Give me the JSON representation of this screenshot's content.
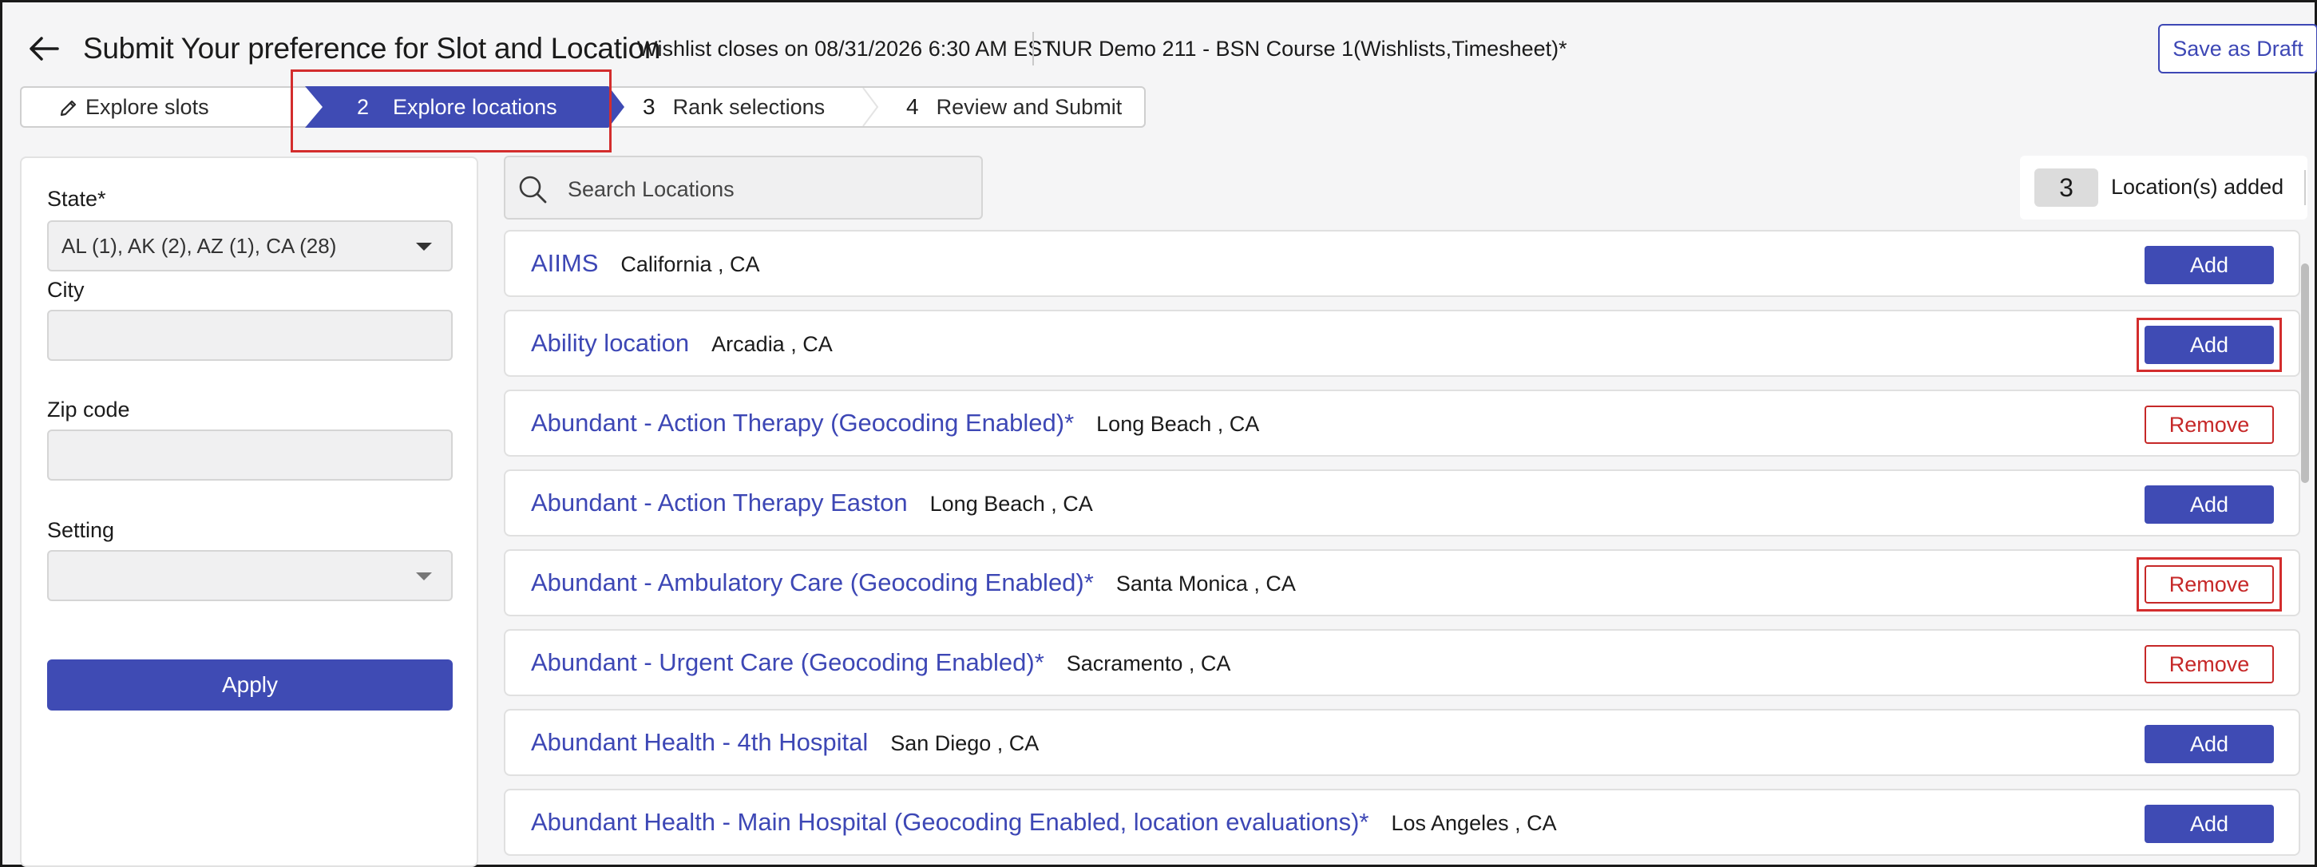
{
  "header": {
    "title": "Submit Your preference for Slot and Location",
    "wishlist_note": "Wishlist closes on 08/31/2026 6:30 AM EST",
    "course": "NUR Demo 211 - BSN Course 1(Wishlists,Timesheet)*",
    "save_draft_label": "Save as Draft"
  },
  "stepper": {
    "steps": [
      {
        "num": "",
        "label": "Explore slots",
        "state": "completed"
      },
      {
        "num": "2",
        "label": "Explore locations",
        "state": "active"
      },
      {
        "num": "3",
        "label": "Rank selections",
        "state": "upcoming"
      },
      {
        "num": "4",
        "label": "Review and Submit",
        "state": "upcoming"
      }
    ]
  },
  "filters": {
    "state_label": "State",
    "state_required_mark": "*",
    "state_value": "AL (1), AK (2), AZ (1), CA (28)",
    "city_label": "City",
    "city_value": "",
    "zip_label": "Zip code",
    "zip_value": "",
    "setting_label": "Setting",
    "setting_value": "",
    "apply_label": "Apply"
  },
  "search": {
    "placeholder": "Search Locations"
  },
  "locations_added": {
    "count": "3",
    "label": "Location(s) added"
  },
  "locations": [
    {
      "name": "AIIMS",
      "city": "California , CA",
      "action": "Add"
    },
    {
      "name": "Ability location",
      "city": "Arcadia , CA",
      "action": "Add"
    },
    {
      "name": "Abundant - Action Therapy (Geocoding Enabled)*",
      "city": "Long Beach , CA",
      "action": "Remove"
    },
    {
      "name": "Abundant - Action Therapy Easton",
      "city": "Long Beach , CA",
      "action": "Add"
    },
    {
      "name": "Abundant - Ambulatory Care (Geocoding Enabled)*",
      "city": "Santa Monica , CA",
      "action": "Remove"
    },
    {
      "name": "Abundant - Urgent Care (Geocoding Enabled)*",
      "city": "Sacramento , CA",
      "action": "Remove"
    },
    {
      "name": "Abundant Health - 4th Hospital",
      "city": "San Diego , CA",
      "action": "Add"
    },
    {
      "name": "Abundant Health - Main Hospital (Geocoding Enabled, location evaluations)*",
      "city": "Los Angeles , CA",
      "action": "Add"
    }
  ],
  "colors": {
    "primary": "#3f4bb4",
    "link": "#3d47b5",
    "remove": "#c62828",
    "highlight": "#d32d2d"
  }
}
